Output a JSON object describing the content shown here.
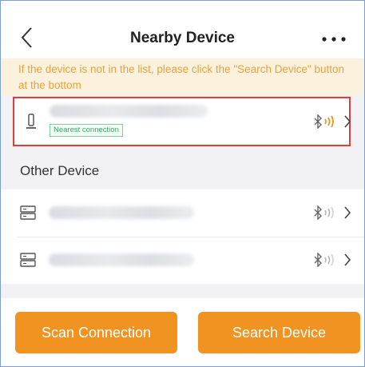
{
  "header": {
    "title": "Nearby Device",
    "back_icon": "chevron-left-icon",
    "more_icon": "ellipsis-icon"
  },
  "notice": {
    "text": "If the device is not in the list, please click the \"Search Device\" button at the bottom"
  },
  "nearest_device": {
    "badge": "Nearest connection",
    "icon": "lock-device-icon",
    "signal_icon": "bluetooth-signal-icon",
    "signal_color": "#f19320"
  },
  "other_section": {
    "label": "Other Device",
    "devices": [
      {
        "icon": "gateway-device-icon",
        "signal_icon": "bluetooth-signal-icon"
      },
      {
        "icon": "gateway-device-icon",
        "signal_icon": "bluetooth-signal-icon"
      }
    ]
  },
  "footer": {
    "scan_label": "Scan Connection",
    "search_label": "Search Device"
  },
  "colors": {
    "accent": "#f19320",
    "highlight_border": "#e53b3b",
    "notice_bg": "#fbf1dc",
    "notice_text": "#e7a23d",
    "badge_green": "#39a86a"
  }
}
